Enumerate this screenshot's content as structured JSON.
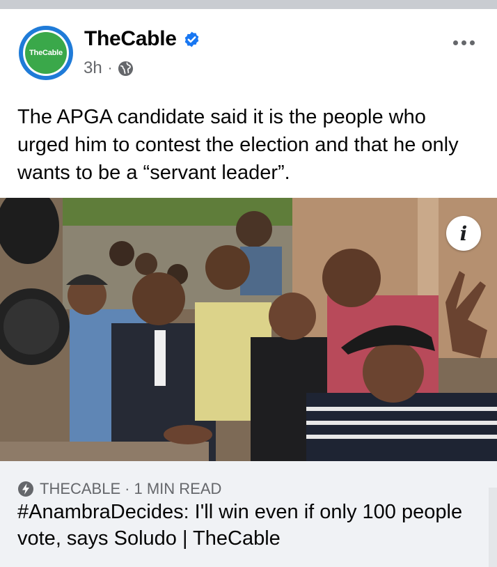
{
  "post": {
    "page_name": "TheCable",
    "avatar_text": "TheCable",
    "timestamp": "3h",
    "separator": "·",
    "audience_icon": "globe-icon",
    "verified_icon": "verified-badge-icon",
    "more_icon": "more-options-icon",
    "caption": "The APGA candidate said it is the people who urged him to contest the election and that he only wants to be a “servant leader”."
  },
  "photo": {
    "info_label": "i"
  },
  "link_preview": {
    "source_icon": "bolt-icon",
    "source": "THECABLE",
    "separator": "·",
    "read_time": "1 MIN READ",
    "title": "#AnambraDecides: I'll win even if only 100 people vote, says Soludo | TheCable"
  },
  "colors": {
    "brand_green": "#3aa84a",
    "ring_blue": "#1f7bd8",
    "verified_blue": "#1877f2",
    "secondary_text": "#65676b",
    "link_box_bg": "#f0f2f5"
  }
}
